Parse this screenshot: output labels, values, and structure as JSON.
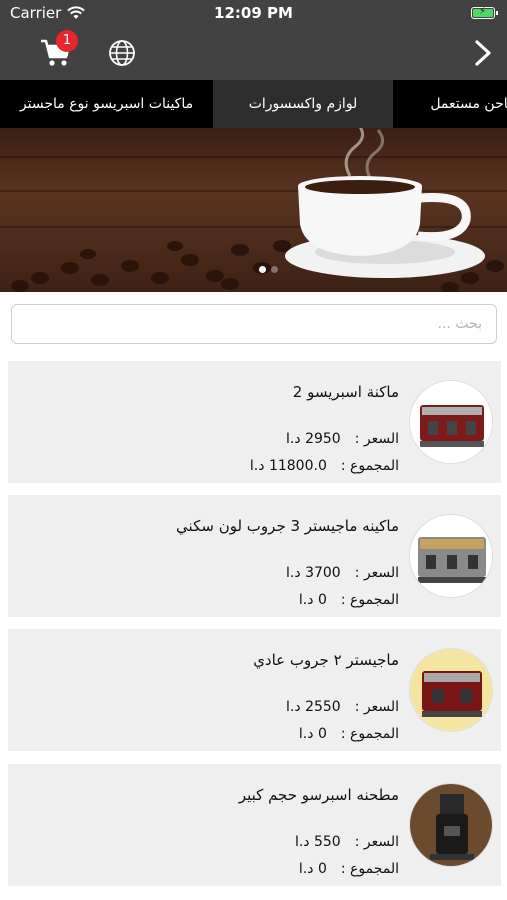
{
  "status_bar": {
    "carrier": "Carrier",
    "time": "12:09 PM"
  },
  "nav": {
    "cart_badge": "1"
  },
  "tabs": [
    {
      "label": "ماكينات اسبريسو نوع ماجستر",
      "active": false
    },
    {
      "label": "لوازم واكسسورات",
      "active": true
    },
    {
      "label": "مطاحن مستعمل",
      "active": false
    }
  ],
  "banner": {
    "dots": [
      {
        "active": true
      },
      {
        "active": false
      }
    ]
  },
  "search": {
    "placeholder": "بحث ..."
  },
  "labels": {
    "price": "السعر :",
    "total": "المجموع :"
  },
  "products": [
    {
      "name": "ماكنة اسبريسو 2",
      "price": "2950 د.ا",
      "total": "11800.0 د.ا"
    },
    {
      "name": "ماكينه ماجيستر 3 جروب لون سكني",
      "price": "3700 د.ا",
      "total": "0 د.ا"
    },
    {
      "name": "ماجيستر ٢ جروب عادي",
      "price": "2550 د.ا",
      "total": "0 د.ا"
    },
    {
      "name": "مطحنه اسبرسو حجم كبير",
      "price": "550 د.ا",
      "total": "0 د.ا"
    }
  ],
  "colors": {
    "header_bg": "#424242",
    "tabs_bg": "#000000",
    "badge": "#e8262e",
    "card_bg": "#efefef"
  }
}
